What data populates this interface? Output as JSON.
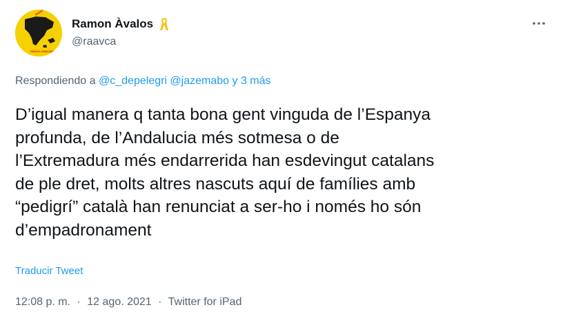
{
  "author": {
    "display_name": "Ramon Àvalos",
    "handle": "@raavca",
    "avatar_icon": "catalan-countries-map-logo",
    "badge_icon": "yellow-ribbon-icon",
    "avatar_text_top": "INDEPENDENCIA",
    "avatar_text_bottom": "PAÏSOS CATALANS"
  },
  "reply_context": {
    "prefix": "Respondiendo a",
    "mentions": [
      "@c_depelegri",
      "@jazemabo"
    ],
    "suffix": "y 3 más"
  },
  "tweet": {
    "lines": [
      "D’igual manera q tanta bona gent vinguda de l’Espanya",
      "profunda, de l’Andalucia més sotmesa o de",
      "l’Extremadura més endarrerida han esdevingut catalans",
      "de ple dret, molts altres nascuts aquí de famílies amb",
      "“pedigrí” català han renunciat a ser-ho i només ho són",
      "d’empadronament"
    ],
    "translate_label": "Traducir Tweet"
  },
  "meta": {
    "time": "12:08 p. m.",
    "date": "12 ago. 2021",
    "source": "Twitter for iPad",
    "separator": "·"
  },
  "colors": {
    "text": "#0f1419",
    "secondary": "#536471",
    "link": "#1d9bf0",
    "avatar_bg": "#f6d000",
    "ribbon": "#f5c518"
  }
}
